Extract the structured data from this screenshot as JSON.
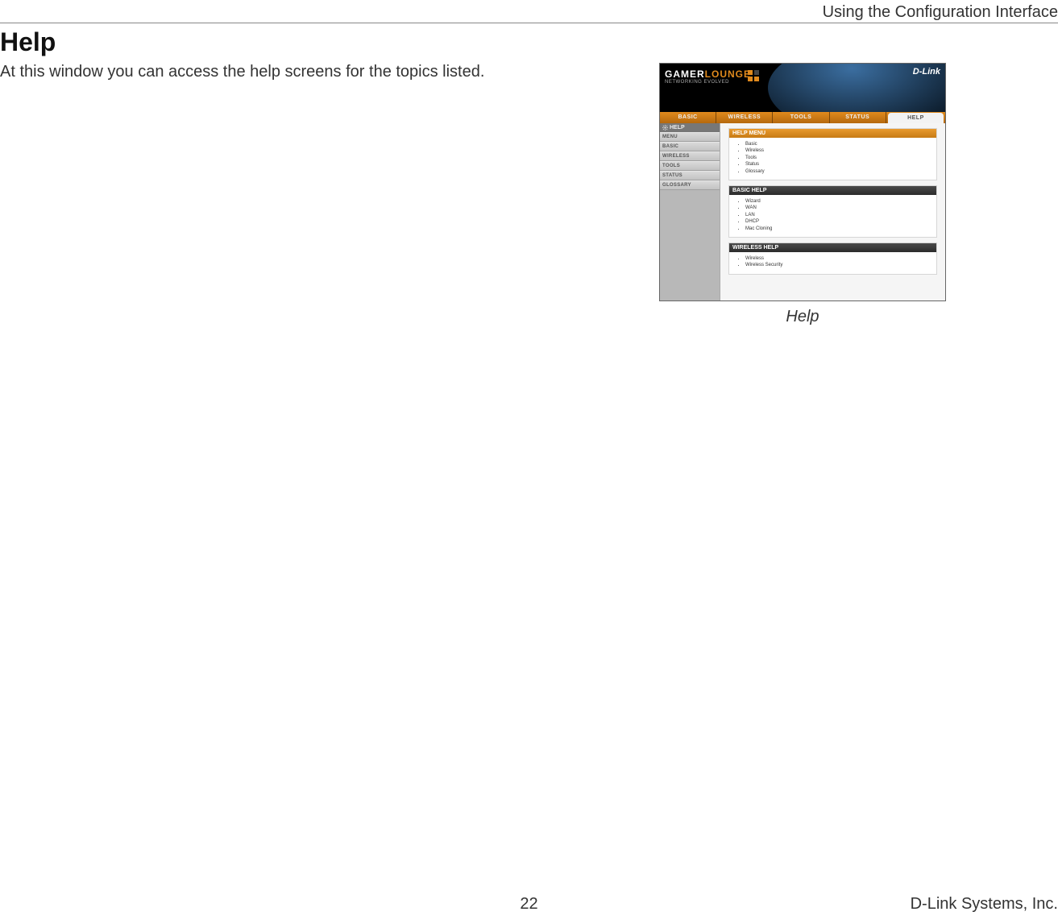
{
  "header": {
    "right_text": "Using the Configuration Interface"
  },
  "title": "Help",
  "intro": "At this window you can access the help screens for the topics listed.",
  "figure": {
    "caption": "Help"
  },
  "router": {
    "banner": {
      "brand_main": "GAMER",
      "brand_accent": "LOUNGE",
      "brand_sub": "NETWORKING EVOLVED",
      "dlink": "D-Link"
    },
    "nav": {
      "tabs": [
        {
          "label": "BASIC"
        },
        {
          "label": "WIRELESS"
        },
        {
          "label": "TOOLS"
        },
        {
          "label": "STATUS"
        },
        {
          "label": "HELP"
        }
      ],
      "active_index": 4
    },
    "sidebar": {
      "header": "HELP",
      "items": [
        {
          "label": "MENU"
        },
        {
          "label": "BASIC"
        },
        {
          "label": "WIRELESS"
        },
        {
          "label": "TOOLS"
        },
        {
          "label": "STATUS"
        },
        {
          "label": "GLOSSARY"
        }
      ]
    },
    "panels": [
      {
        "title": "HELP MENU",
        "style": "orange",
        "items": [
          "Basic",
          "Wireless",
          "Tools",
          "Status",
          "Glossary"
        ]
      },
      {
        "title": "BASIC HELP",
        "style": "dark",
        "items": [
          "Wizard",
          "WAN",
          "LAN",
          "DHCP",
          "Mac Cloning"
        ]
      },
      {
        "title": "WIRELESS HELP",
        "style": "dark",
        "items": [
          "Wireless",
          "Wireless Security"
        ]
      }
    ]
  },
  "footer": {
    "page_number": "22",
    "company": "D-Link Systems, Inc."
  }
}
